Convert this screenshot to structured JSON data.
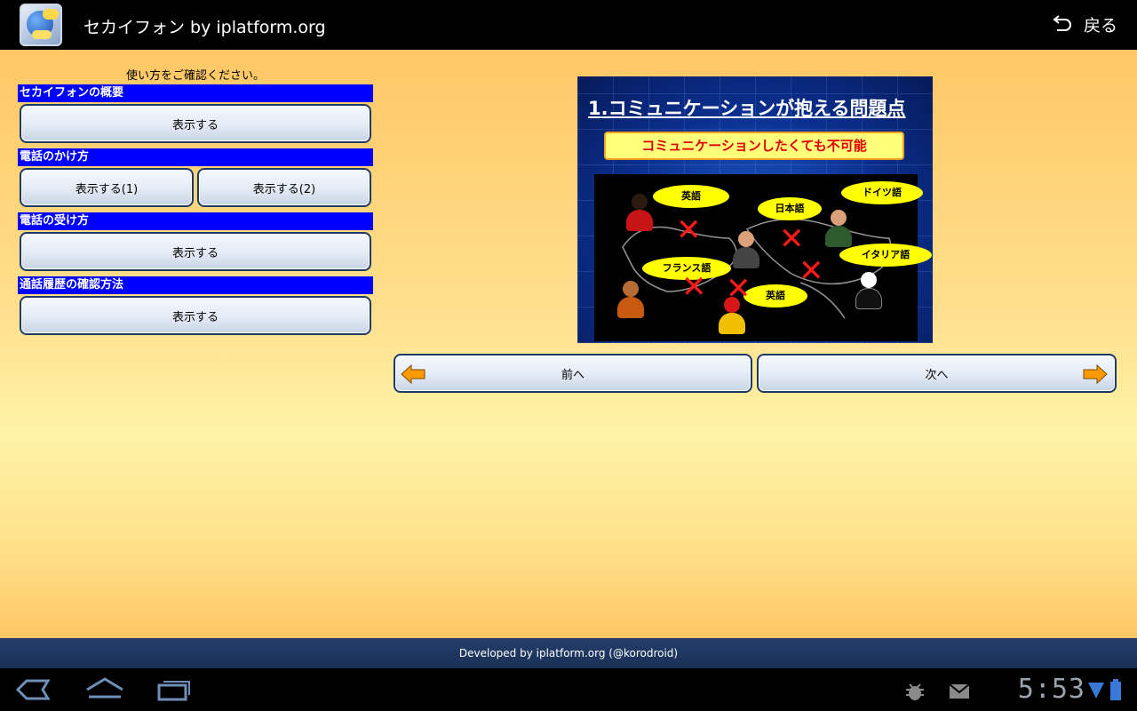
{
  "actionbar": {
    "app_title": "セカイフォン by iplatform.org",
    "back_label": "戻る"
  },
  "instruction": "使い方をご確認ください。",
  "sections": [
    {
      "header": "セカイフォンの概要",
      "buttons": [
        "表示する"
      ]
    },
    {
      "header": "電話のかけ方",
      "buttons": [
        "表示する(1)",
        "表示する(2)"
      ]
    },
    {
      "header": "電話の受け方",
      "buttons": [
        "表示する"
      ]
    },
    {
      "header": "通話履歴の確認方法",
      "buttons": [
        "表示する"
      ]
    }
  ],
  "slide": {
    "title": "1.コミュニケーションが抱える問題点",
    "banner": "コミュニケーションしたくても不可能",
    "bubbles": [
      "英語",
      "日本語",
      "ドイツ語",
      "フランス語",
      "イタリア語",
      "英語"
    ]
  },
  "nav": {
    "prev_label": "前へ",
    "next_label": "次へ"
  },
  "footer": "Developed by iplatform.org (@korodroid)",
  "system": {
    "clock": "5:53"
  },
  "colors": {
    "section_header_bg": "#0000ff",
    "button_border": "#1d3a66",
    "slide_banner_text": "#e00000",
    "arrow_fill": "#ff9900"
  }
}
